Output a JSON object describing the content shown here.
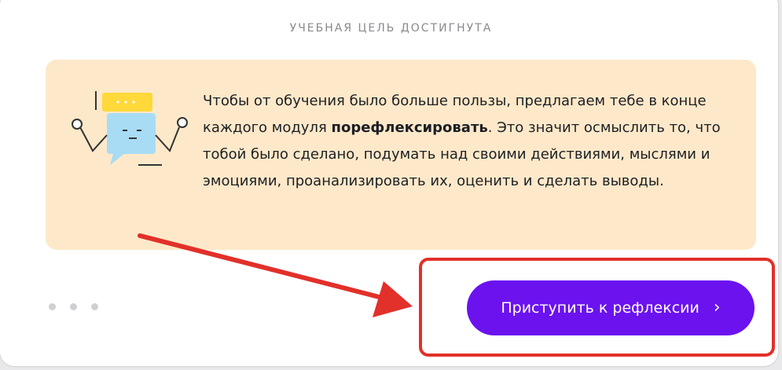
{
  "header": {
    "title": "УЧЕБНАЯ ЦЕЛЬ ДОСТИГНУТА"
  },
  "info": {
    "illustration_icon": "chat-bubbles-icon",
    "text_before": "Чтобы от обучения было больше пользы, предлагаем тебе в конце каждого модуля ",
    "text_bold": "порефлексировать",
    "text_after": ". Это значит осмыслить то, что тобой было сделано, подумать над своими действиями, мыслями и эмоциями, проанализировать их, оценить и сделать выводы.",
    "background_color": "#fde9c9"
  },
  "pagination": {
    "dot_count": 3
  },
  "cta": {
    "label": "Приступить к рефлексии",
    "chevron": "›",
    "color": "#6b12ef"
  },
  "annotation": {
    "highlight_color": "#e2302a"
  }
}
